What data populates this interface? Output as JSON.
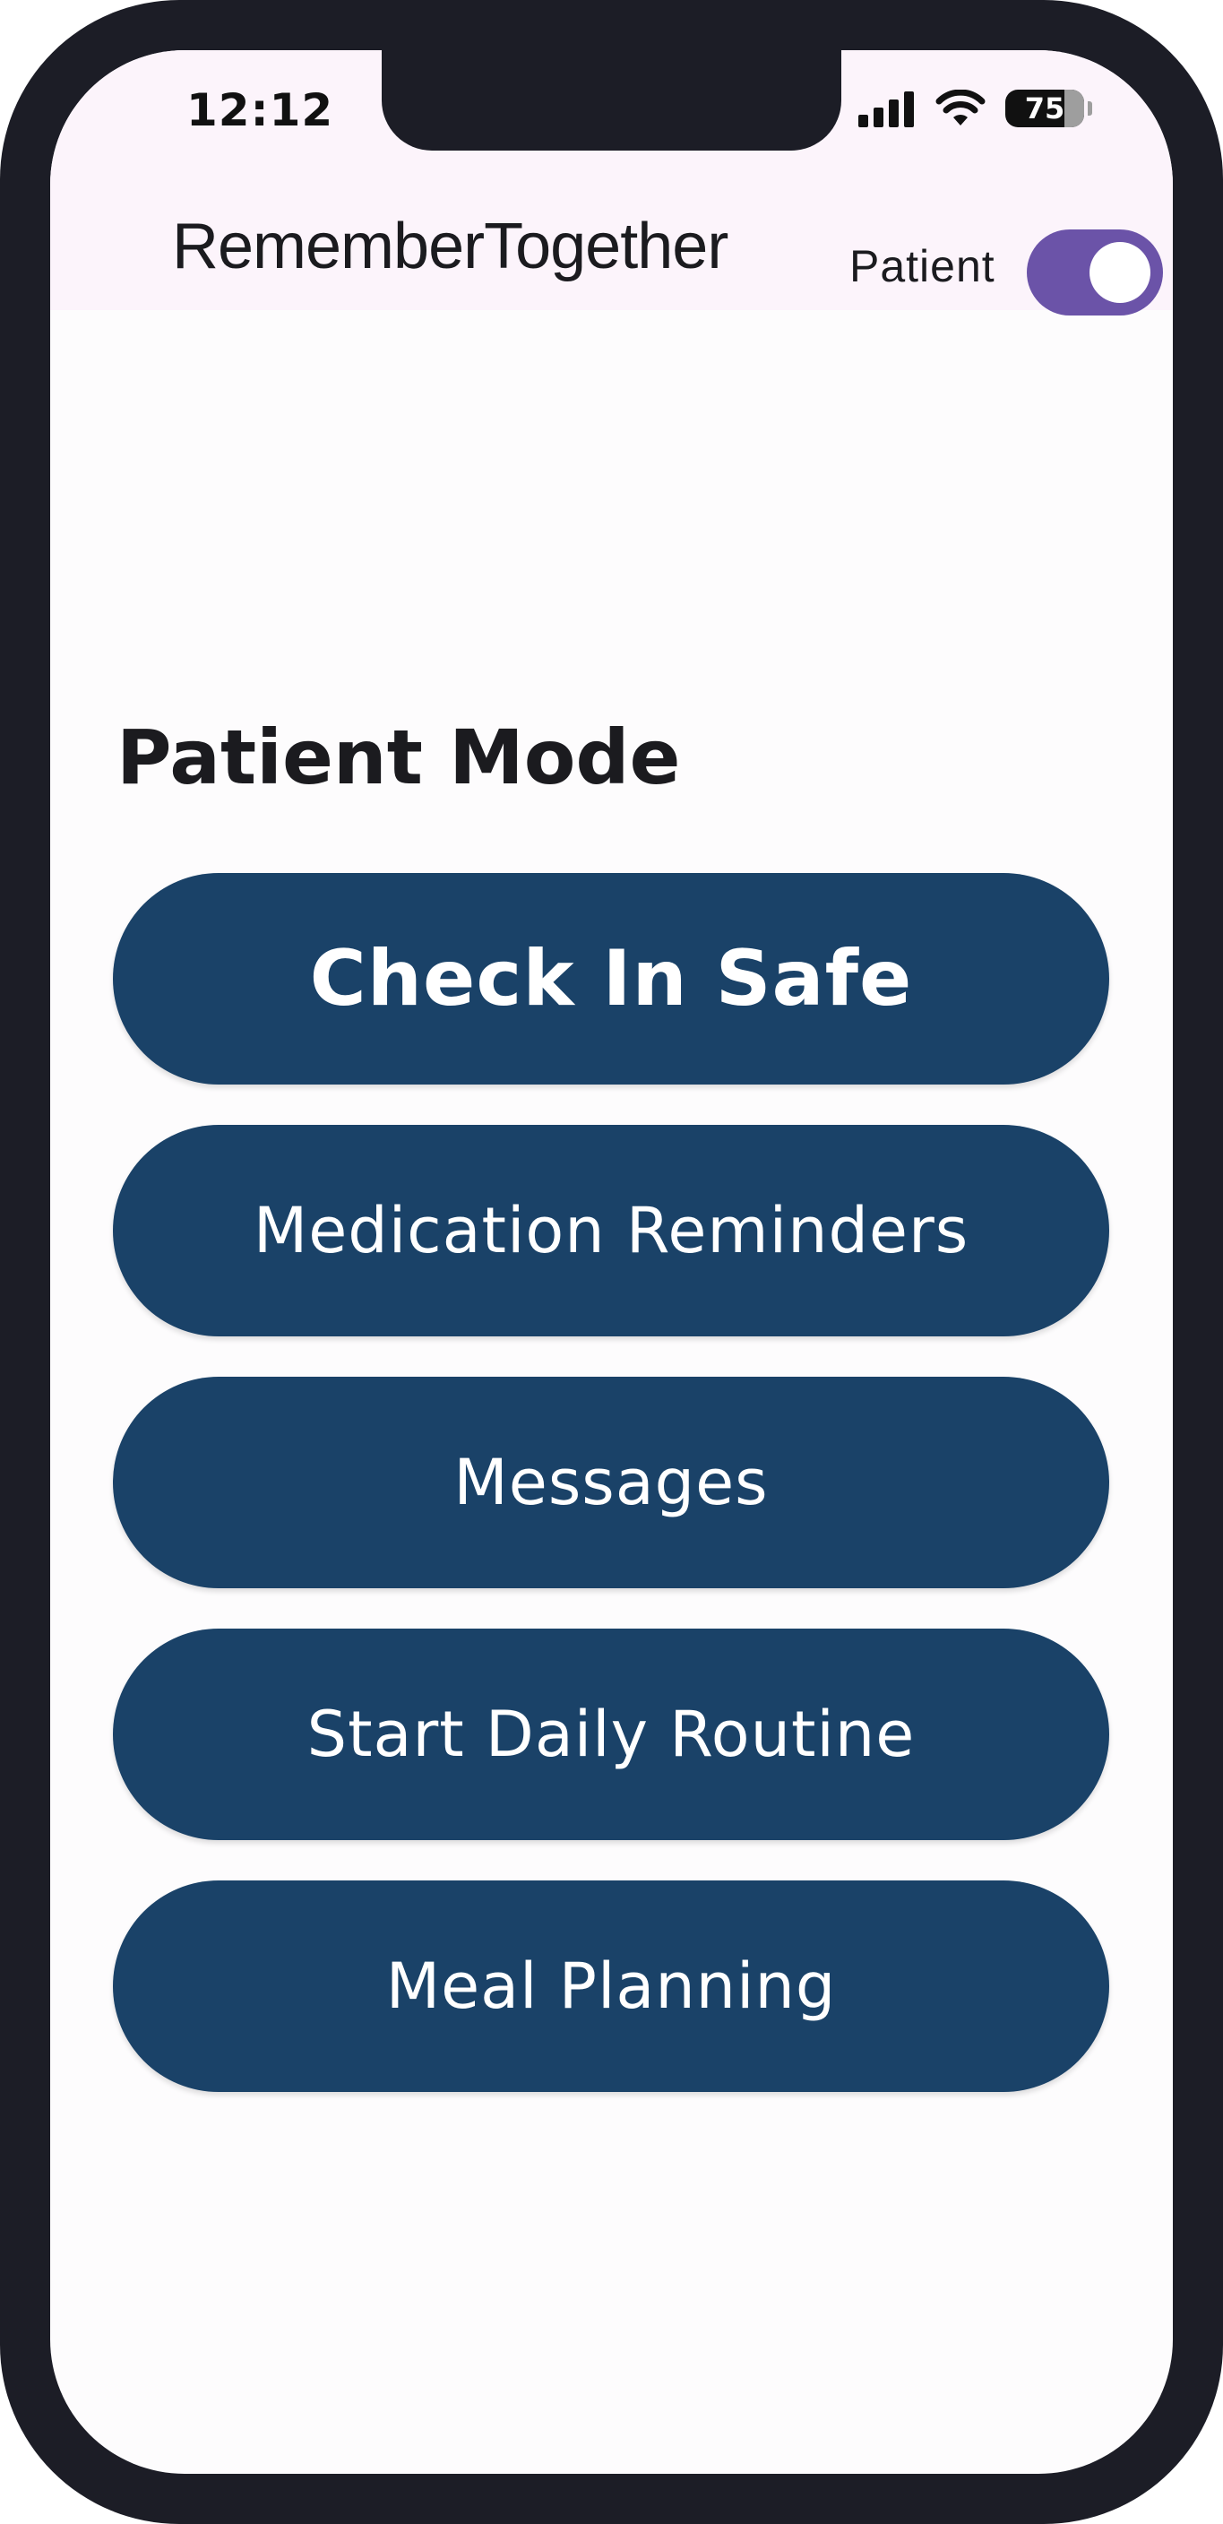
{
  "status_bar": {
    "time": "12:12",
    "battery": "75",
    "icons": [
      "signal-icon",
      "wifi-icon",
      "battery-icon"
    ]
  },
  "app_bar": {
    "title": "RememberTogether",
    "mode_label": "Patient",
    "toggle_on": true
  },
  "main": {
    "section_title": "Patient Mode",
    "buttons": [
      {
        "label": "Check In Safe"
      },
      {
        "label": "Medication Reminders"
      },
      {
        "label": "Messages"
      },
      {
        "label": "Start Daily Routine"
      },
      {
        "label": "Meal Planning"
      }
    ]
  },
  "colors": {
    "accent": "#6b53a8",
    "button": "#1a4268",
    "app_bar_bg": "#fcf4fb",
    "frame": "#1c1d26"
  }
}
